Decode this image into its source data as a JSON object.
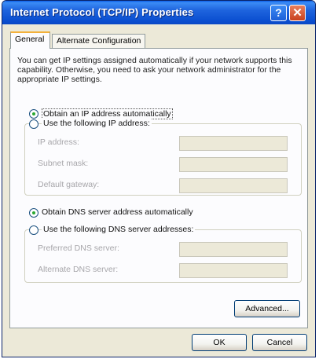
{
  "window": {
    "title": "Internet Protocol (TCP/IP) Properties",
    "help_glyph": "?",
    "close_glyph": "✕"
  },
  "tabs": [
    {
      "label": "General",
      "active": true
    },
    {
      "label": "Alternate Configuration",
      "active": false
    }
  ],
  "description": "You can get IP settings assigned automatically if your network supports this capability. Otherwise, you need to ask your network administrator for the appropriate IP settings.",
  "ip": {
    "auto_label": "Obtain an IP address automatically",
    "manual_label": "Use the following IP address:",
    "selected": "auto",
    "fields": [
      {
        "label": "IP address:",
        "value": ""
      },
      {
        "label": "Subnet mask:",
        "value": ""
      },
      {
        "label": "Default gateway:",
        "value": ""
      }
    ]
  },
  "dns": {
    "auto_label": "Obtain DNS server address automatically",
    "manual_label": "Use the following DNS server addresses:",
    "selected": "auto",
    "fields": [
      {
        "label": "Preferred DNS server:",
        "value": ""
      },
      {
        "label": "Alternate DNS server:",
        "value": ""
      }
    ]
  },
  "buttons": {
    "advanced": "Advanced...",
    "ok": "OK",
    "cancel": "Cancel"
  },
  "colors": {
    "titlebar": "#0b4fd0",
    "dialog_bg": "#ece9d8",
    "radio_selected": "#2aa830",
    "tab_highlight": "#f3b13a"
  }
}
